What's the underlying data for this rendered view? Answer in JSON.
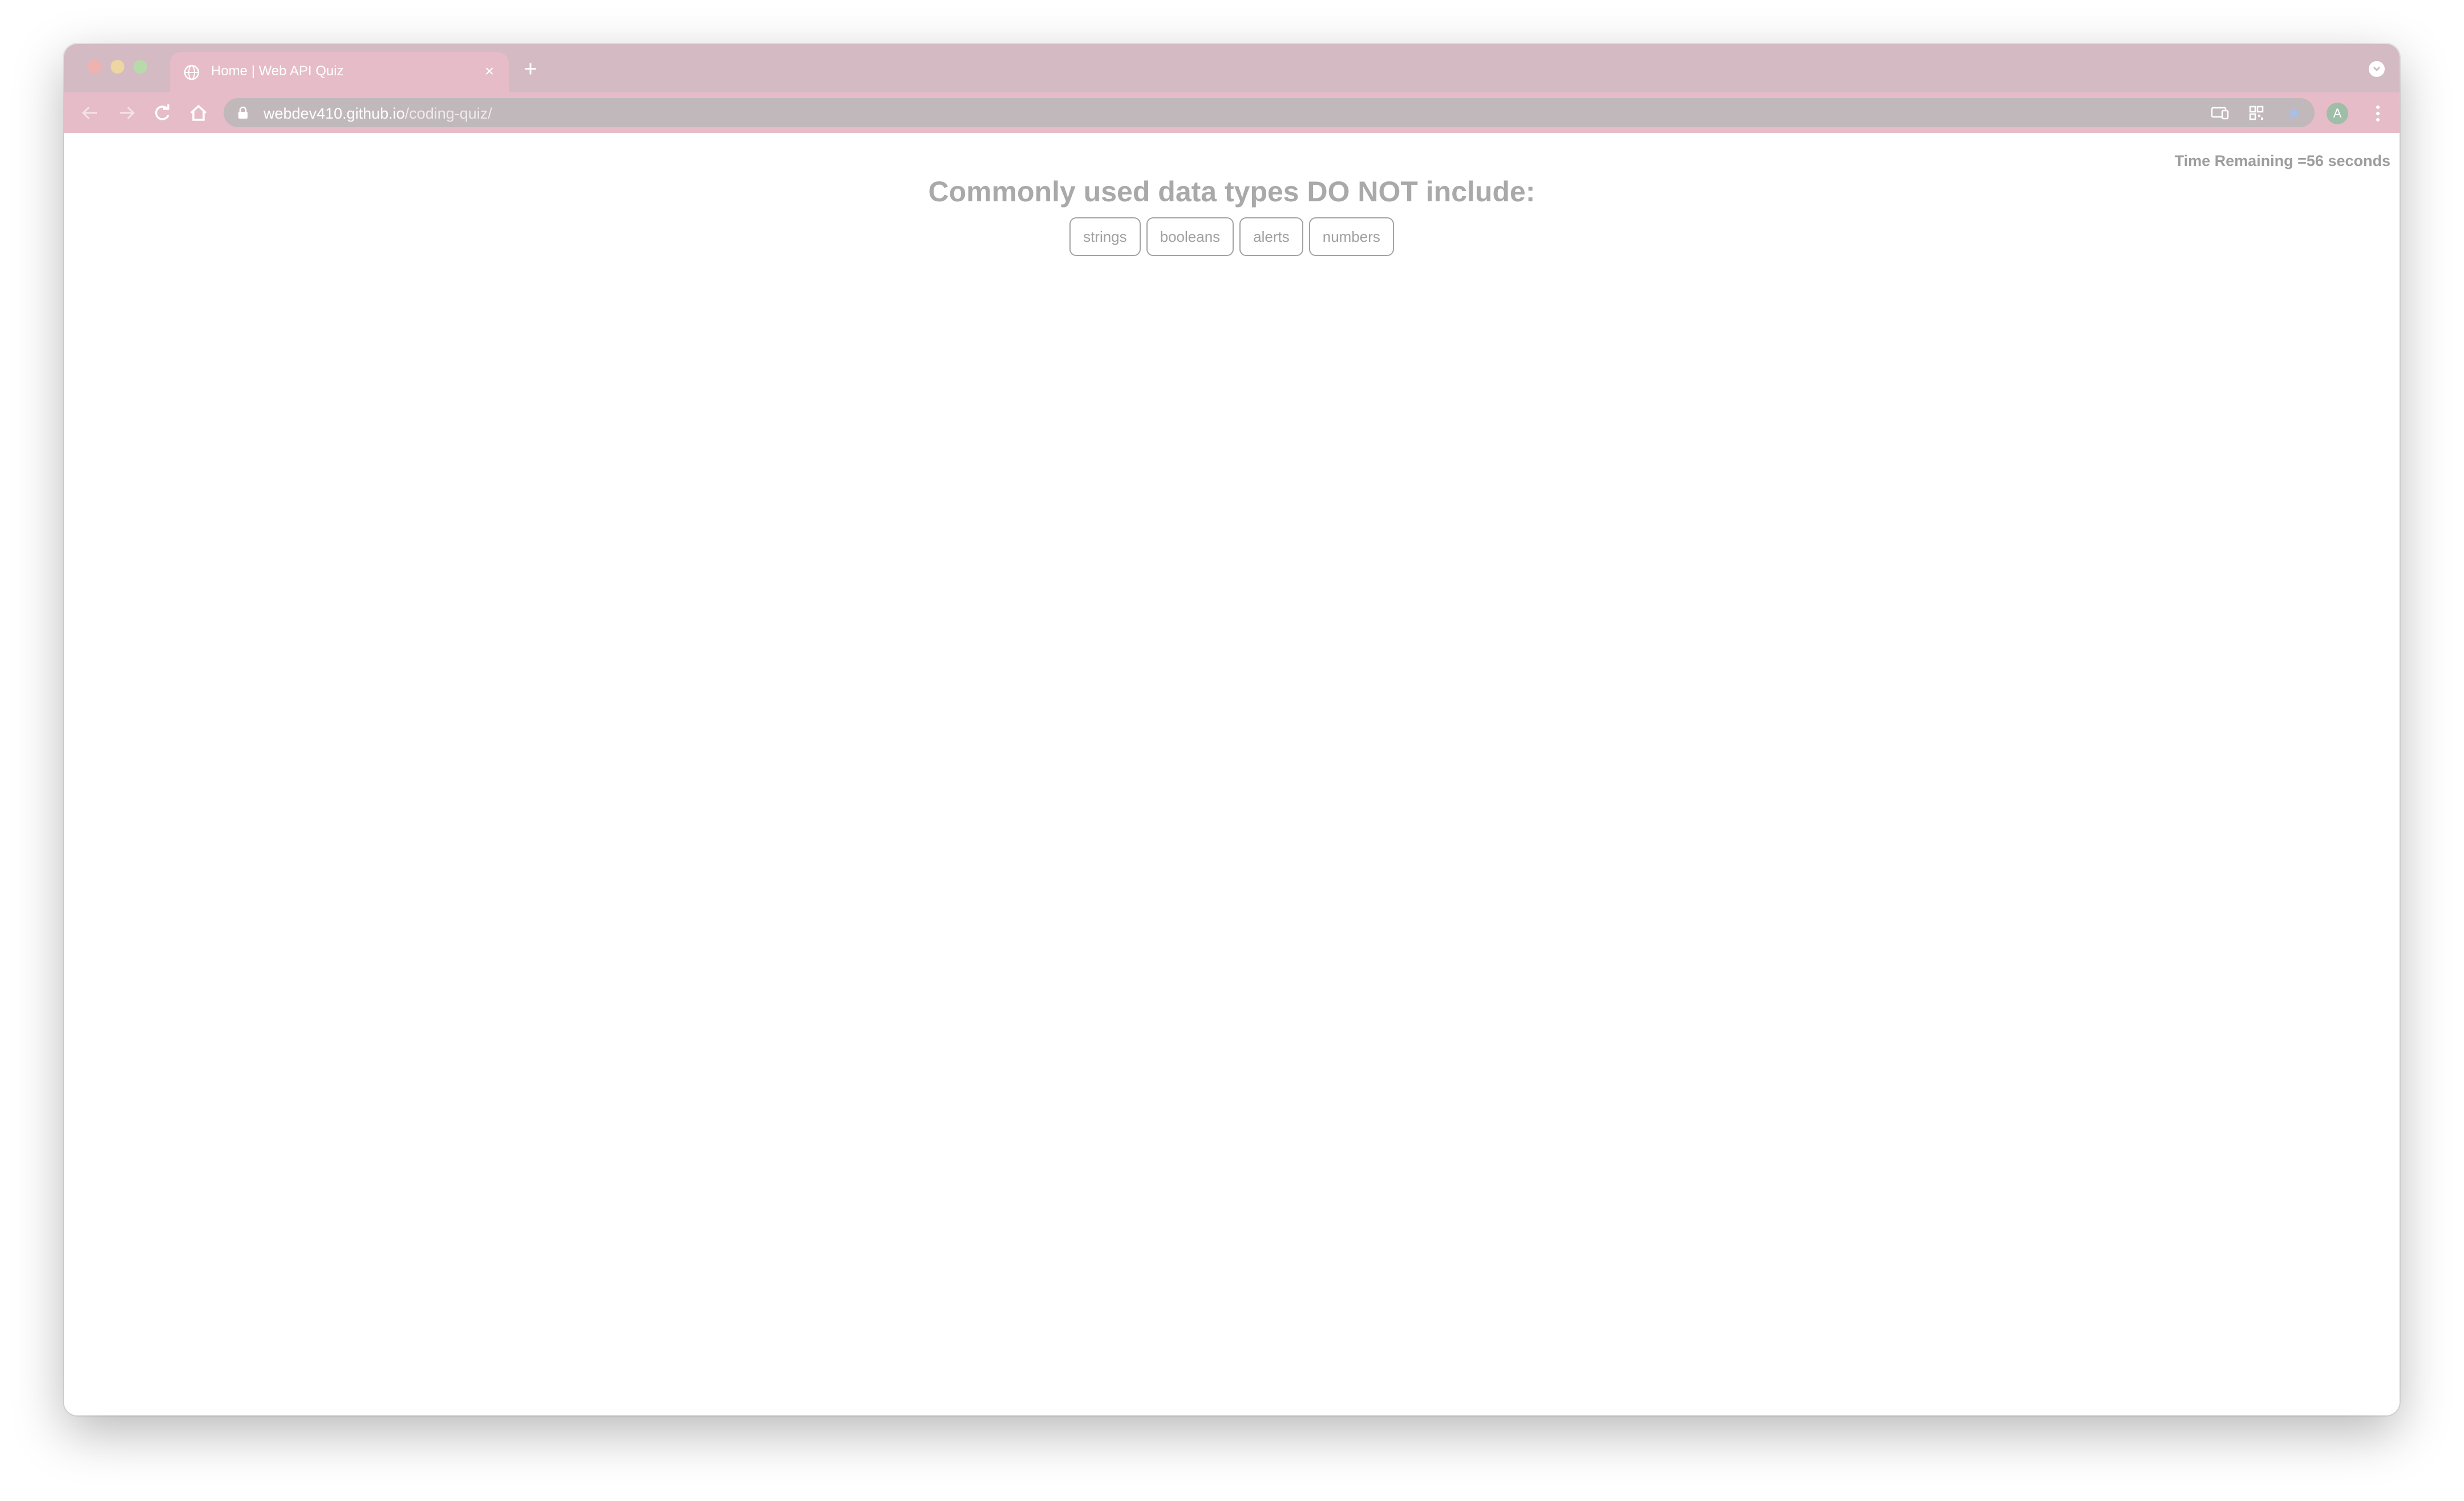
{
  "browser": {
    "tab": {
      "title": "Home | Web API Quiz",
      "close_glyph": "×",
      "favicon": "globe-icon"
    },
    "new_tab_glyph": "+",
    "address": {
      "host": "webdev410.github.io",
      "path": "/coding-quiz/"
    },
    "profile_initial": "A",
    "colors": {
      "tabstrip": "#d3bac3",
      "toolbar": "#e6bcc8",
      "omnibox": "#c0b8bb"
    }
  },
  "quiz": {
    "timer_text": "Time Remaining =56 seconds",
    "question": "Commonly used data types DO NOT include:",
    "choices": [
      {
        "label": "strings"
      },
      {
        "label": "booleans"
      },
      {
        "label": "alerts"
      },
      {
        "label": "numbers"
      }
    ]
  }
}
